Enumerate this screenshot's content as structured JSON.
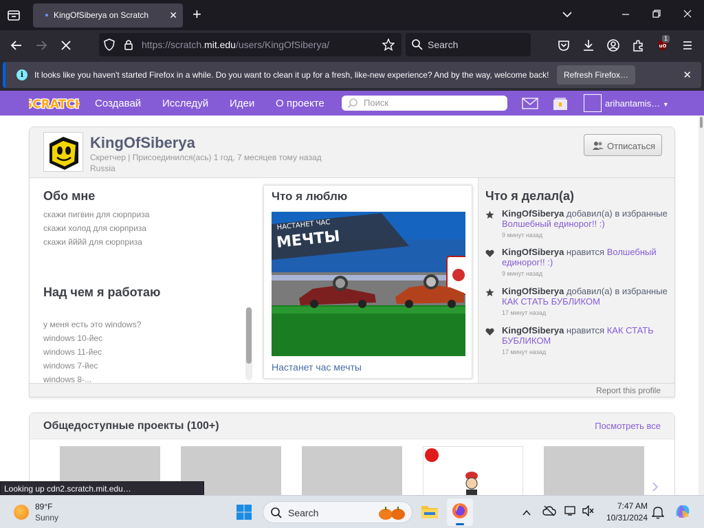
{
  "browser": {
    "tab_title": "KingOfSiberya on Scratch",
    "url_prefix": "https://scratch.",
    "url_host": "mit.edu",
    "url_path": "/users/KingOfSiberya/",
    "search_placeholder": "Search",
    "extension_badge": "1",
    "notification_text": "It looks like you haven't started Firefox in a while. Do you want to clean it up for a fresh, like-new experience? And by the way, welcome back!",
    "notification_button": "Refresh Firefox…",
    "status_text": "Looking up cdn2.scratch.mit.edu…"
  },
  "scratch_nav": {
    "logo_text": "SCRATCH",
    "items": [
      "Создавай",
      "Исследуй",
      "Идеи",
      "О проекте"
    ],
    "search_placeholder": "Поиск",
    "username": "arihantamis…"
  },
  "profile": {
    "username": "KingOfSiberya",
    "role": "Скретчер",
    "joined": "Присоединился(ась) 1 год, 7 месяцев тому назад",
    "country": "Russia",
    "unfollow_label": "Отписаться"
  },
  "about": {
    "title": "Обо мне",
    "lines": [
      "скажи пигвин для сюрприза",
      "скажи холод для сюрприза",
      "скажи йййй для сюрприза"
    ]
  },
  "working_on": {
    "title": "Над чем я работаю",
    "lines": [
      "у меня есть это windows?",
      "windows 10-йес",
      "windows 11-йес",
      "windows 7-йес",
      "windows 8-..."
    ]
  },
  "favorite": {
    "title": "Что я люблю",
    "thumb_text_top": "НАСТАНЕТ ЧАС",
    "thumb_text_main": "МЕЧТЫ",
    "project_title": "Настанет час мечты"
  },
  "activity": {
    "title": "Что я делал(а)",
    "items": [
      {
        "icon": "star",
        "user": "KingOfSiberya",
        "action": "добавил(а) в избранные",
        "target": "Волшебный единорог!! :)",
        "time": "9 минут назад"
      },
      {
        "icon": "heart",
        "user": "KingOfSiberya",
        "action": "нравится",
        "target": "Волшебный единорог!! :)",
        "time": "9 минут назад"
      },
      {
        "icon": "star",
        "user": "KingOfSiberya",
        "action": "добавил(а) в избранные",
        "target": "КАК СТАТЬ БУБЛИКОМ",
        "time": "17 минут назад"
      },
      {
        "icon": "heart",
        "user": "KingOfSiberya",
        "action": "нравится",
        "target": "КАК СТАТЬ БУБЛИКОМ",
        "time": "17 минут назад"
      }
    ]
  },
  "report_link": "Report this profile",
  "shared_projects": {
    "title": "Общедоступные проекты (100+)",
    "view_all": "Посмотреть все"
  },
  "taskbar": {
    "temperature": "89°F",
    "condition": "Sunny",
    "search_label": "Search",
    "time": "7:47 AM",
    "date": "10/31/2024"
  },
  "colors": {
    "scratch_purple": "#855cd6",
    "firefox_dark": "#1c1b22",
    "link_blue": "#4a6ba7"
  }
}
